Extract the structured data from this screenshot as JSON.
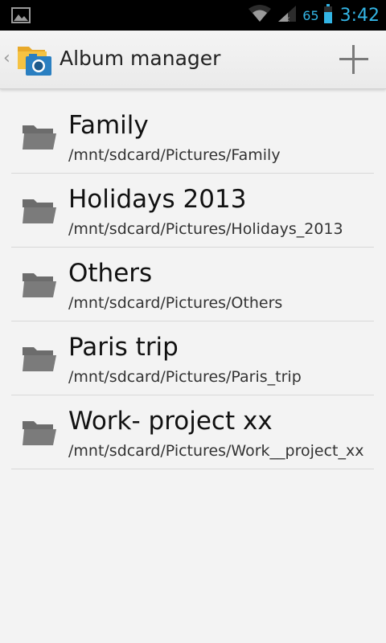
{
  "status_bar": {
    "battery_percent": "65",
    "time": "3:42",
    "icons": [
      "image-notification-icon",
      "wifi-icon",
      "signal-icon",
      "battery-icon"
    ]
  },
  "action_bar": {
    "title": "Album manager",
    "app_icon": "album-folder-camera-icon",
    "up_icon": "up-caret-icon",
    "add_icon": "plus-icon"
  },
  "albums": [
    {
      "name": "Family",
      "path": "/mnt/sdcard/Pictures/Family"
    },
    {
      "name": "Holidays 2013",
      "path": "/mnt/sdcard/Pictures/Holidays_2013"
    },
    {
      "name": "Others",
      "path": "/mnt/sdcard/Pictures/Others"
    },
    {
      "name": "Paris trip",
      "path": "/mnt/sdcard/Pictures/Paris_trip"
    },
    {
      "name": "Work- project xx",
      "path": "/mnt/sdcard/Pictures/Work__project_xx"
    }
  ],
  "colors": {
    "status_accent": "#33b5e5",
    "folder_gray": "#7b7b7b",
    "folder_yellow": "#f5c242",
    "camera_blue": "#2a7fc1"
  }
}
